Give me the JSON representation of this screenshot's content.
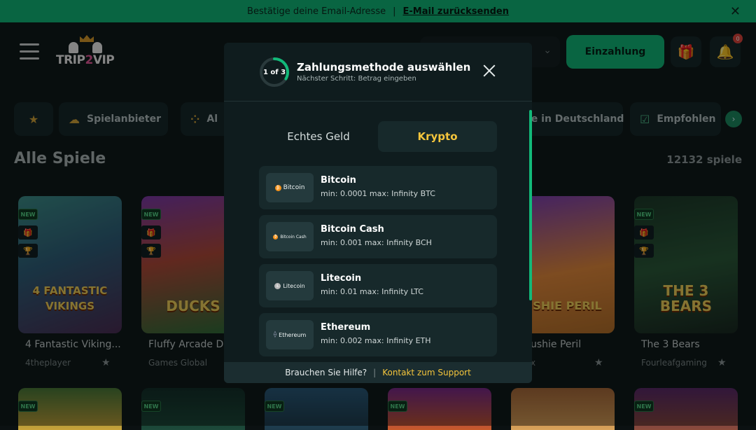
{
  "banner": {
    "message": "Bestätige deine Email-Adresse",
    "separator": "|",
    "resend_link": "E-Mail zurücksenden"
  },
  "header": {
    "logo_text_a": "TRIP",
    "logo_text_b": "2",
    "logo_text_c": "VIP",
    "deposit_label": "Einzahlung",
    "notification_count": "0"
  },
  "categories": [
    {
      "label": "",
      "icon": "star-icon"
    },
    {
      "label": "Spielanbieter",
      "icon": "provider-icon"
    },
    {
      "label": "Al",
      "icon": "grid-icon"
    },
    {
      "label": "le in Deutschland",
      "icon": ""
    },
    {
      "label": "Empfohlen",
      "icon": "check-icon"
    }
  ],
  "lobby": {
    "title": "Alle Spiele",
    "count": "12132 spiele"
  },
  "games": [
    {
      "name": "4 Fantastic Viking...",
      "provider": "4theplayer",
      "art": "4 FANTASTIC VIKINGS",
      "tag": "NEW"
    },
    {
      "name": "Fluffy Arcade Do",
      "provider": "Games Global",
      "art": "DUCKS",
      "tag": "NEW"
    },
    {
      "name": "ushie Peril",
      "provider": "x",
      "art": "USHIE PERIL",
      "tag": ""
    },
    {
      "name": "The 3 Bears",
      "provider": "Fourleafgaming",
      "art": "THE 3 BEARS",
      "tag": "NEW"
    }
  ],
  "second_row_tags": [
    "NEW",
    "NEW",
    "NEW",
    "NEW",
    "",
    "NEW"
  ],
  "modal": {
    "step": "1 of 3",
    "title": "Zahlungsmethode auswählen",
    "subtitle": "Nächster Schritt: Betrag eingeben",
    "tabs": {
      "fiat": "Echtes Geld",
      "crypto": "Krypto"
    },
    "active_tab": "crypto",
    "methods": [
      {
        "logo": "Bitcoin",
        "coin_color": "#f7931a",
        "name": "Bitcoin",
        "limits": "min: 0.0001 max: Infinity BTC"
      },
      {
        "logo": "Bitcoin Cash",
        "coin_color": "#f7931a",
        "name": "Bitcoin Cash",
        "limits": "min: 0.001 max: Infinity BCH"
      },
      {
        "logo": "Litecoin",
        "coin_color": "#b8b8b8",
        "name": "Litecoin",
        "limits": "min: 0.01 max: Infinity LTC"
      },
      {
        "logo": "Ethereum",
        "coin_color": "#8a8fa8",
        "name": "Ethereum",
        "limits": "min: 0.002 max: Infinity ETH"
      }
    ],
    "footer": {
      "help": "Brauchen Sie Hilfe?",
      "separator": "|",
      "support_link": "Kontakt zum Support"
    },
    "step_progress": 0.333
  },
  "colors": {
    "accent_green": "#12b979",
    "accent_gold": "#f4c53c",
    "panel": "#17292b"
  }
}
